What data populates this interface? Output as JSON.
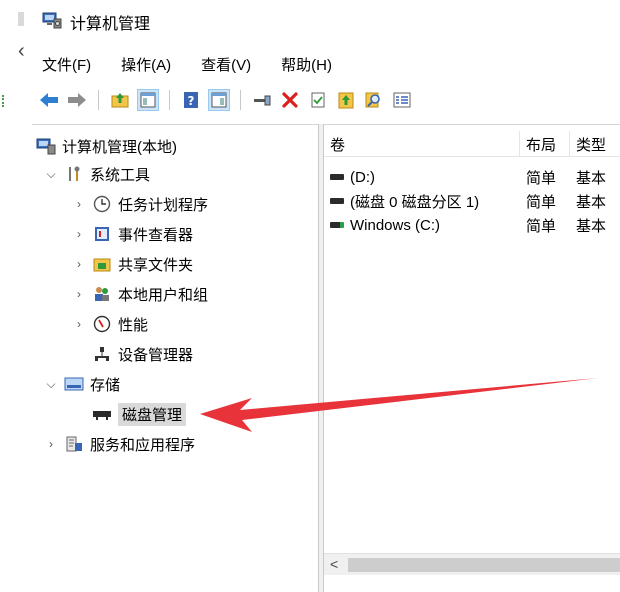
{
  "window": {
    "title": "计算机管理"
  },
  "menu": {
    "items": [
      "文件(F)",
      "操作(A)",
      "查看(V)",
      "帮助(H)"
    ]
  },
  "toolbar": {
    "buttons": [
      "back-arrow-icon",
      "forward-arrow-icon",
      "up-folder-icon",
      "show-hide-tree-icon",
      "help-icon",
      "show-hide-action-icon",
      "connect-icon",
      "delete-icon",
      "properties-icon",
      "export-icon",
      "search-icon",
      "list-icon"
    ]
  },
  "tree": {
    "root": "计算机管理(本地)",
    "system_tools": "系统工具",
    "task_scheduler": "任务计划程序",
    "event_viewer": "事件查看器",
    "shared_folders": "共享文件夹",
    "local_users": "本地用户和组",
    "performance": "性能",
    "device_manager": "设备管理器",
    "storage": "存储",
    "disk_management": "磁盘管理",
    "services_apps": "服务和应用程序"
  },
  "list": {
    "columns": [
      "卷",
      "布局",
      "类型"
    ],
    "rows": [
      {
        "volume": "(D:)",
        "layout": "简单",
        "type": "基本"
      },
      {
        "volume": "(磁盘 0 磁盘分区 1)",
        "layout": "简单",
        "type": "基本"
      },
      {
        "volume": "Windows (C:)",
        "layout": "简单",
        "type": "基本"
      }
    ]
  },
  "scrollbar": {
    "left_arrow": "<"
  },
  "colors": {
    "annotation_arrow": "#e8333a",
    "selection": "#d9d9d9"
  }
}
